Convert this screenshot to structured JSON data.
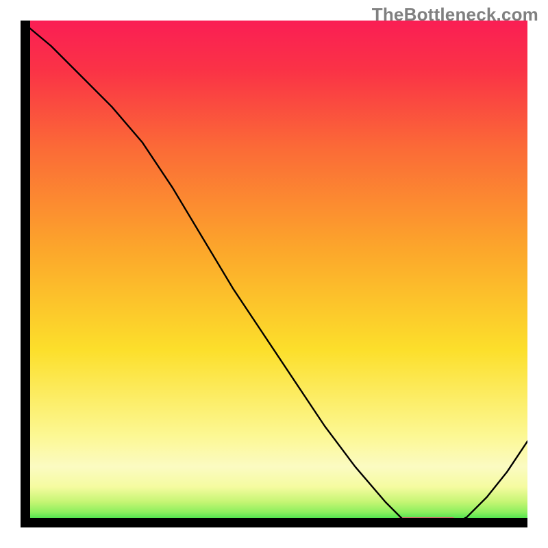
{
  "watermark": "TheBottleneck.com",
  "chart_data": {
    "type": "line",
    "title": "",
    "xlabel": "",
    "ylabel": "",
    "xlim": [
      0,
      100
    ],
    "ylim": [
      0,
      100
    ],
    "grid": false,
    "legend": false,
    "series": [
      {
        "name": "curve",
        "x": [
          0,
          6,
          12,
          18,
          24,
          30,
          36,
          42,
          48,
          54,
          60,
          66,
          72,
          76,
          80,
          84,
          88,
          92,
          96,
          100
        ],
        "y": [
          100,
          95,
          89,
          83,
          76,
          67,
          57,
          47,
          38,
          29,
          20,
          12,
          5,
          1,
          0,
          0,
          2,
          6,
          11,
          17
        ]
      }
    ],
    "optimal_marker": {
      "x_start": 74,
      "x_end": 86,
      "y": 1.2,
      "color": "#d96a6f"
    },
    "gradient_stops": [
      {
        "offset": 0.0,
        "color": "#00d43a"
      },
      {
        "offset": 0.015,
        "color": "#42e24a"
      },
      {
        "offset": 0.03,
        "color": "#8cef5e"
      },
      {
        "offset": 0.05,
        "color": "#c4f573"
      },
      {
        "offset": 0.08,
        "color": "#f5fba0"
      },
      {
        "offset": 0.12,
        "color": "#fbfbc2"
      },
      {
        "offset": 0.18,
        "color": "#fcf894"
      },
      {
        "offset": 0.35,
        "color": "#fcdf2b"
      },
      {
        "offset": 0.55,
        "color": "#fca62b"
      },
      {
        "offset": 0.75,
        "color": "#fb6a37"
      },
      {
        "offset": 0.9,
        "color": "#fa3346"
      },
      {
        "offset": 1.0,
        "color": "#fa1e54"
      }
    ]
  }
}
